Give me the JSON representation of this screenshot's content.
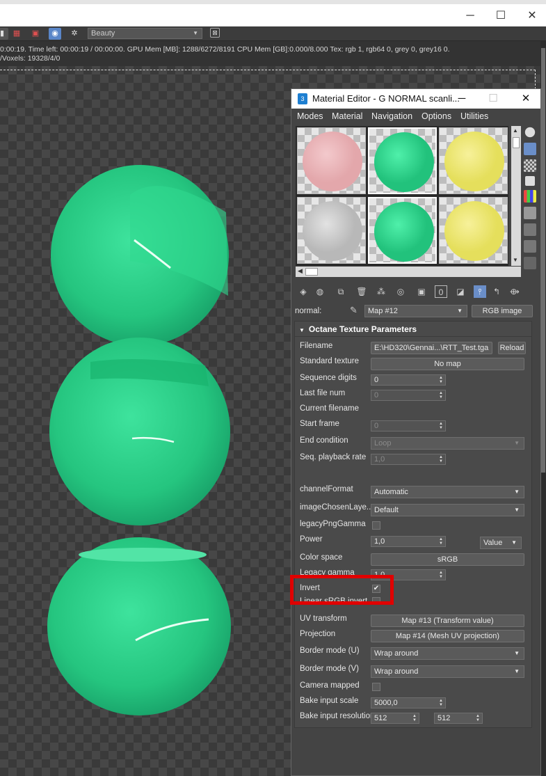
{
  "window": {
    "minimize": "─",
    "maximize": "☐",
    "close": "✕"
  },
  "toolbar": {
    "render_mode": "Beauty"
  },
  "status": {
    "line1": "0:00:19.   Time left: 00:00:19 / 00:00:00.   GPU Mem [MB]: 1288/6272/8191   CPU Mem [GB]:0.000/8.000   Tex: rgb 1, rgb64 0, grey 0, grey16 0.",
    "line2": "/Voxels: 19328/4/0"
  },
  "material_editor": {
    "title": "Material Editor - G NORMAL scanli...",
    "app_icon": "3",
    "menu": [
      "Modes",
      "Material",
      "Navigation",
      "Options",
      "Utilities"
    ],
    "slots": [
      {
        "color": "#e3a7ab",
        "highlight": "#f3c9cc"
      },
      {
        "color": "#22c27c",
        "highlight": "#4ff0aa"
      },
      {
        "color": "#e5df5c",
        "highlight": "#f7f19a"
      },
      {
        "color": "#b8b8b8",
        "highlight": "#e2e2e2"
      },
      {
        "color": "#22c27c",
        "highlight": "#4ff0aa"
      },
      {
        "color": "#e5df5c",
        "highlight": "#f7f19a"
      }
    ],
    "normal_label": "normal:",
    "map_name": "Map #12",
    "map_type": "RGB image",
    "rollout_title": "Octane Texture Parameters",
    "params": {
      "filename_label": "Filename",
      "filename_value": "E:\\HD320\\Gennai...\\RTT_Test.tga",
      "reload": "Reload",
      "standard_texture_label": "Standard texture",
      "standard_texture_value": "No map",
      "sequence_digits_label": "Sequence digits",
      "sequence_digits_value": "0",
      "last_file_num_label": "Last file num",
      "last_file_num_value": "0",
      "current_filename_label": "Current filename",
      "start_frame_label": "Start frame",
      "start_frame_value": "0",
      "end_condition_label": "End condition",
      "end_condition_value": "Loop",
      "seq_playback_rate_label": "Seq. playback rate",
      "seq_playback_rate_value": "1,0",
      "channel_format_label": "channelFormat",
      "channel_format_value": "Automatic",
      "image_chosen_layer_label": "imageChosenLaye...",
      "image_chosen_layer_value": "Default",
      "legacy_png_gamma_label": "legacyPngGamma",
      "power_label": "Power",
      "power_value": "1,0",
      "power_mode": "Value",
      "color_space_label": "Color space",
      "color_space_value": "sRGB",
      "legacy_gamma_label": "Legacy gamma",
      "legacy_gamma_value": "1,0",
      "invert_label": "Invert",
      "invert_check": "✔",
      "linear_sgb_label": "Linear sRGB invert",
      "uv_transform_label": "UV transform",
      "uv_transform_value": "Map #13 (Transform value)",
      "projection_label": "Projection",
      "projection_value": "Map #14 (Mesh UV projection)",
      "border_u_label": "Border mode (U)",
      "border_u_value": "Wrap around",
      "border_v_label": "Border mode (V)",
      "border_v_value": "Wrap around",
      "camera_mapped_label": "Camera mapped",
      "bake_input_scale_label": "Bake input scale",
      "bake_input_scale_value": "5000,0",
      "bake_input_resolution_label": "Bake input resolution",
      "bake_res_x": "512",
      "bake_res_y": "512"
    }
  }
}
